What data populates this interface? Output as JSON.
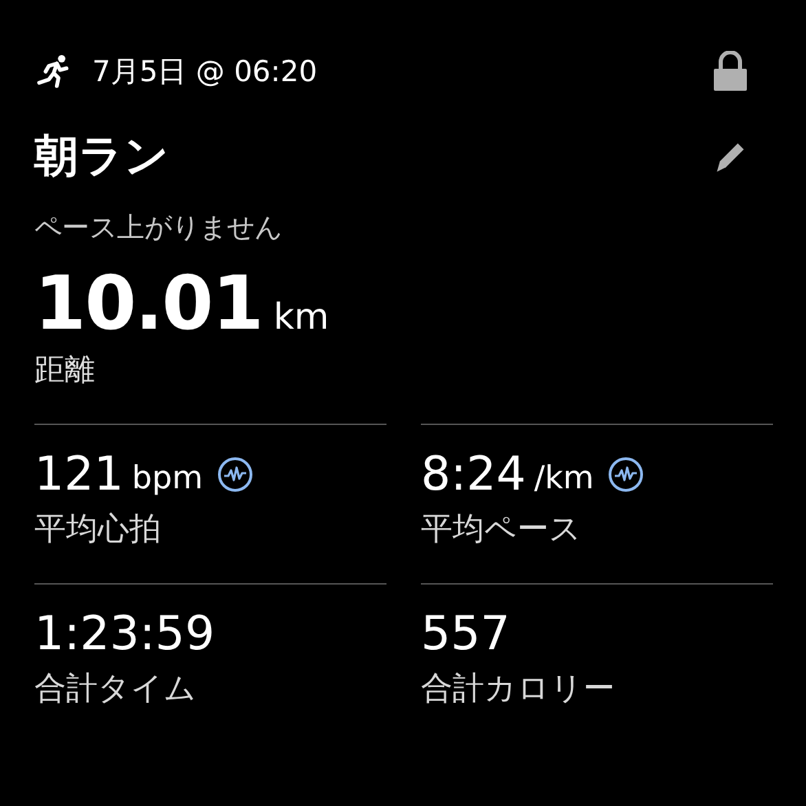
{
  "header": {
    "datetime": "7月5日 @ 06:20",
    "locked": true
  },
  "title": "朝ラン",
  "subtitle": "ペース上がりません",
  "main_stat": {
    "value": "10.01",
    "unit": "km",
    "label": "距離"
  },
  "stats": [
    {
      "value": "121",
      "unit": "bpm",
      "label": "平均心拍",
      "chart_link": true
    },
    {
      "value": "8:24",
      "unit": "/km",
      "label": "平均ペース",
      "chart_link": true
    },
    {
      "value": "1:23:59",
      "label": "合計タイム",
      "chart_link": false
    },
    {
      "value": "557",
      "label": "合計カロリー",
      "chart_link": false
    }
  ]
}
